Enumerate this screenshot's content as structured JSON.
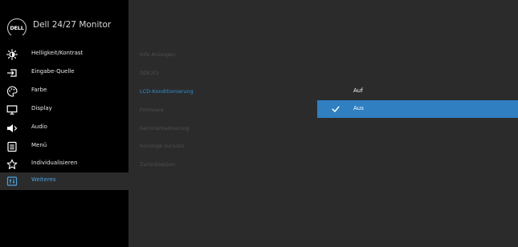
{
  "header": {
    "logo_text": "DELL",
    "model": "Dell 24/27 Monitor"
  },
  "sidebar": {
    "items": [
      {
        "label": "Helligkeit/Kontrast",
        "icon": "brightness-icon"
      },
      {
        "label": "Eingabe-Quelle",
        "icon": "input-source-icon"
      },
      {
        "label": "Farbe",
        "icon": "color-palette-icon"
      },
      {
        "label": "Display",
        "icon": "display-icon"
      },
      {
        "label": "Audio",
        "icon": "speaker-icon"
      },
      {
        "label": "Menü",
        "icon": "menu-icon"
      },
      {
        "label": "Individualisieren",
        "icon": "star-icon"
      },
      {
        "label": "Weiteres",
        "icon": "other-icon"
      }
    ],
    "active": "Weiteres"
  },
  "submenu": {
    "items": [
      "Info Anzeigen",
      "DDC/CI",
      "LCD-Konditionierung",
      "Firmware",
      "Servicemarkierung",
      "Sonstige zurücks.",
      "Zurücksetzen"
    ],
    "active": "LCD-Konditionierung"
  },
  "options": {
    "items": [
      "Auf",
      "Aus"
    ],
    "selected": "Aus"
  },
  "colors": {
    "accent": "#2f7fc1",
    "active_text": "#4aa3e0",
    "background": "#2b2b2b",
    "sidebar": "#000000"
  }
}
